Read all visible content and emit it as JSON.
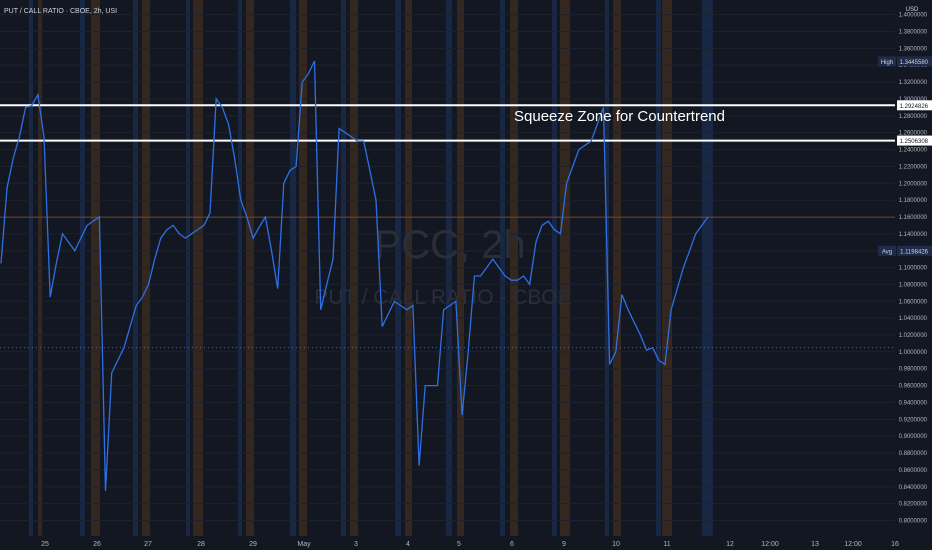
{
  "header": {
    "title": "PUT / CALL RATIO · CBOE, 2h, USI"
  },
  "watermark": {
    "symbol": "PCC, 2h",
    "name": "PUT / CALL RATIO - CBOE"
  },
  "annotation": {
    "text": "Squeeze Zone for Countertrend"
  },
  "colors": {
    "background": "#131722",
    "line": "#2f6fe4",
    "level_line": "#ffffff",
    "avg_line": "#2962ff",
    "last_price_line": "#b8601c",
    "band_blue": "#1a2a4a",
    "band_orange": "#3a2a1e"
  },
  "chart_data": {
    "type": "line",
    "currency": "USD",
    "ylim": [
      0.79,
      1.41
    ],
    "y_ticks": [
      "1.4000000",
      "1.3800000",
      "1.3600000",
      "1.3400000",
      "1.3200000",
      "1.3000000",
      "1.2800000",
      "1.2600000",
      "1.2400000",
      "1.2200000",
      "1.2000000",
      "1.1800000",
      "1.1600000",
      "1.1400000",
      "1.1200000",
      "1.1000000",
      "1.0800000",
      "1.0600000",
      "1.0400000",
      "1.0200000",
      "1.0000000",
      "0.9800000",
      "0.9600000",
      "0.9400000",
      "0.9200000",
      "0.9000000",
      "0.8800000",
      "0.8600000",
      "0.8400000",
      "0.8200000",
      "0.8000000"
    ],
    "x_ticks": [
      "25",
      "26",
      "27",
      "28",
      "29",
      "May",
      "3",
      "4",
      "5",
      "6",
      "9",
      "10",
      "11",
      "12",
      "12:00",
      "13",
      "12:00",
      "16"
    ],
    "series": [
      {
        "values": [
          1.105,
          1.195,
          1.23,
          1.255,
          1.29,
          1.292,
          1.305,
          1.255,
          1.065,
          1.105,
          1.14,
          1.13,
          1.12,
          1.135,
          1.15,
          1.155,
          1.16,
          0.835,
          0.975,
          0.99,
          1.005,
          1.03,
          1.055,
          1.065,
          1.08,
          1.11,
          1.135,
          1.145,
          1.15,
          1.14,
          1.135,
          1.14,
          1.145,
          1.15,
          1.165,
          1.3,
          1.29,
          1.27,
          1.23,
          1.18,
          1.16,
          1.135,
          1.148,
          1.16,
          1.12,
          1.075,
          1.2,
          1.215,
          1.22,
          1.32,
          1.33,
          1.345,
          1.05,
          1.08,
          1.11,
          1.265,
          1.26,
          1.255,
          1.25,
          1.25,
          1.215,
          1.18,
          1.03,
          1.045,
          1.06,
          1.055,
          1.05,
          1.055,
          0.865,
          0.96,
          0.96,
          0.96,
          1.05,
          1.055,
          1.06,
          0.925,
          1.0,
          1.09,
          1.09,
          1.1,
          1.11,
          1.1,
          1.09,
          1.085,
          1.085,
          1.09,
          1.08,
          1.13,
          1.15,
          1.155,
          1.145,
          1.14,
          1.2,
          1.22,
          1.24,
          1.245,
          1.25,
          1.27,
          1.29,
          0.985,
          1.0,
          1.068,
          1.05,
          1.035,
          1.02,
          1.002,
          1.005,
          0.99,
          0.985,
          1.05,
          1.075,
          1.1,
          1.12,
          1.14,
          1.15,
          1.16
        ]
      }
    ],
    "levels": [
      {
        "label": "",
        "value": 1.2924826,
        "text": "1.2924826"
      },
      {
        "label": "",
        "value": 1.2506308,
        "text": "1.2506308"
      }
    ],
    "high": {
      "label": "High",
      "value": 1.344558,
      "text": "1.3445580"
    },
    "avg": {
      "label": "Avg",
      "value": 1.1198426,
      "text": "1.1198426"
    },
    "avg_dotted_value": 1.005,
    "last_value": 1.1598
  }
}
